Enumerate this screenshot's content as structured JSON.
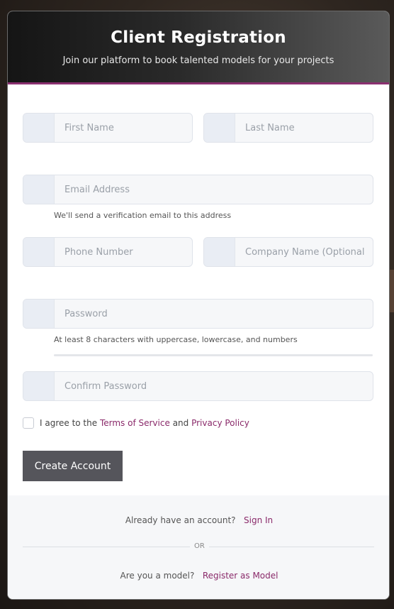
{
  "header": {
    "title": "Client Registration",
    "subtitle": "Join our platform to book talented models for your projects"
  },
  "form": {
    "first_name_placeholder": "First Name",
    "last_name_placeholder": "Last Name",
    "email_placeholder": "Email Address",
    "email_hint": "We'll send a verification email to this address",
    "phone_placeholder": "Phone Number",
    "company_placeholder": "Company Name (Optional",
    "password_placeholder": "Password",
    "password_hint": "At least 8 characters with uppercase, lowercase, and numbers",
    "confirm_password_placeholder": "Confirm Password",
    "terms_prefix": "I agree to the",
    "terms_link": "Terms of Service",
    "terms_and": "and",
    "privacy_link": "Privacy Policy",
    "submit_label": "Create Account"
  },
  "footer": {
    "signin_prompt": "Already have an account?",
    "signin_link": "Sign In",
    "or_label": "OR",
    "model_prompt": "Are you a model?",
    "model_link": "Register as Model"
  },
  "colors": {
    "accent_link": "#8a2a6a",
    "submit_button": "#55555b"
  }
}
